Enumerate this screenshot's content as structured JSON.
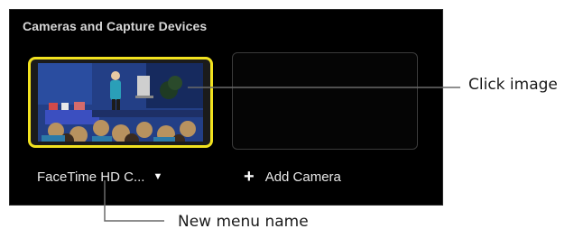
{
  "panel": {
    "title": "Cameras and Capture Devices",
    "selected_camera": "FaceTime HD C...",
    "add_camera_label": "Add Camera"
  },
  "callouts": {
    "image": "Click image",
    "menu": "New menu name"
  },
  "colors": {
    "panel_bg": "#000000",
    "selection_border": "#f2e21f",
    "label_text": "#e8e8e8"
  },
  "icons": [
    "chevron-down-icon",
    "plus-icon"
  ]
}
